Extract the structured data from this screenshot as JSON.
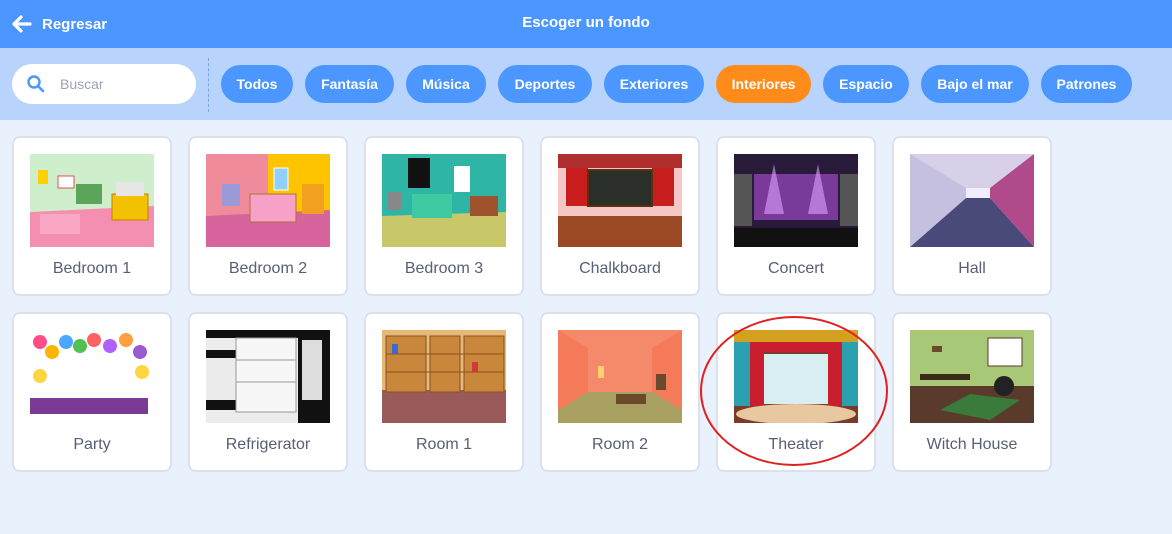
{
  "header": {
    "back_label": "Regresar",
    "title": "Escoger un fondo"
  },
  "search": {
    "placeholder": "Buscar",
    "value": ""
  },
  "tags": [
    {
      "label": "Todos",
      "active": false
    },
    {
      "label": "Fantasía",
      "active": false
    },
    {
      "label": "Música",
      "active": false
    },
    {
      "label": "Deportes",
      "active": false
    },
    {
      "label": "Exteriores",
      "active": false
    },
    {
      "label": "Interiores",
      "active": true
    },
    {
      "label": "Espacio",
      "active": false
    },
    {
      "label": "Bajo el mar",
      "active": false
    },
    {
      "label": "Patrones",
      "active": false
    }
  ],
  "backdrops": [
    {
      "name": "Bedroom 1"
    },
    {
      "name": "Bedroom 2"
    },
    {
      "name": "Bedroom 3"
    },
    {
      "name": "Chalkboard"
    },
    {
      "name": "Concert"
    },
    {
      "name": "Hall"
    },
    {
      "name": "Party"
    },
    {
      "name": "Refrigerator"
    },
    {
      "name": "Room 1"
    },
    {
      "name": "Room 2"
    },
    {
      "name": "Theater",
      "circled": true
    },
    {
      "name": "Witch House"
    }
  ],
  "colors": {
    "header": "#4c97ff",
    "filter_bar": "#b8d3fc",
    "tag": "#4c97ff",
    "tag_active": "#ff8c1a",
    "highlight_circle": "#e02020"
  }
}
